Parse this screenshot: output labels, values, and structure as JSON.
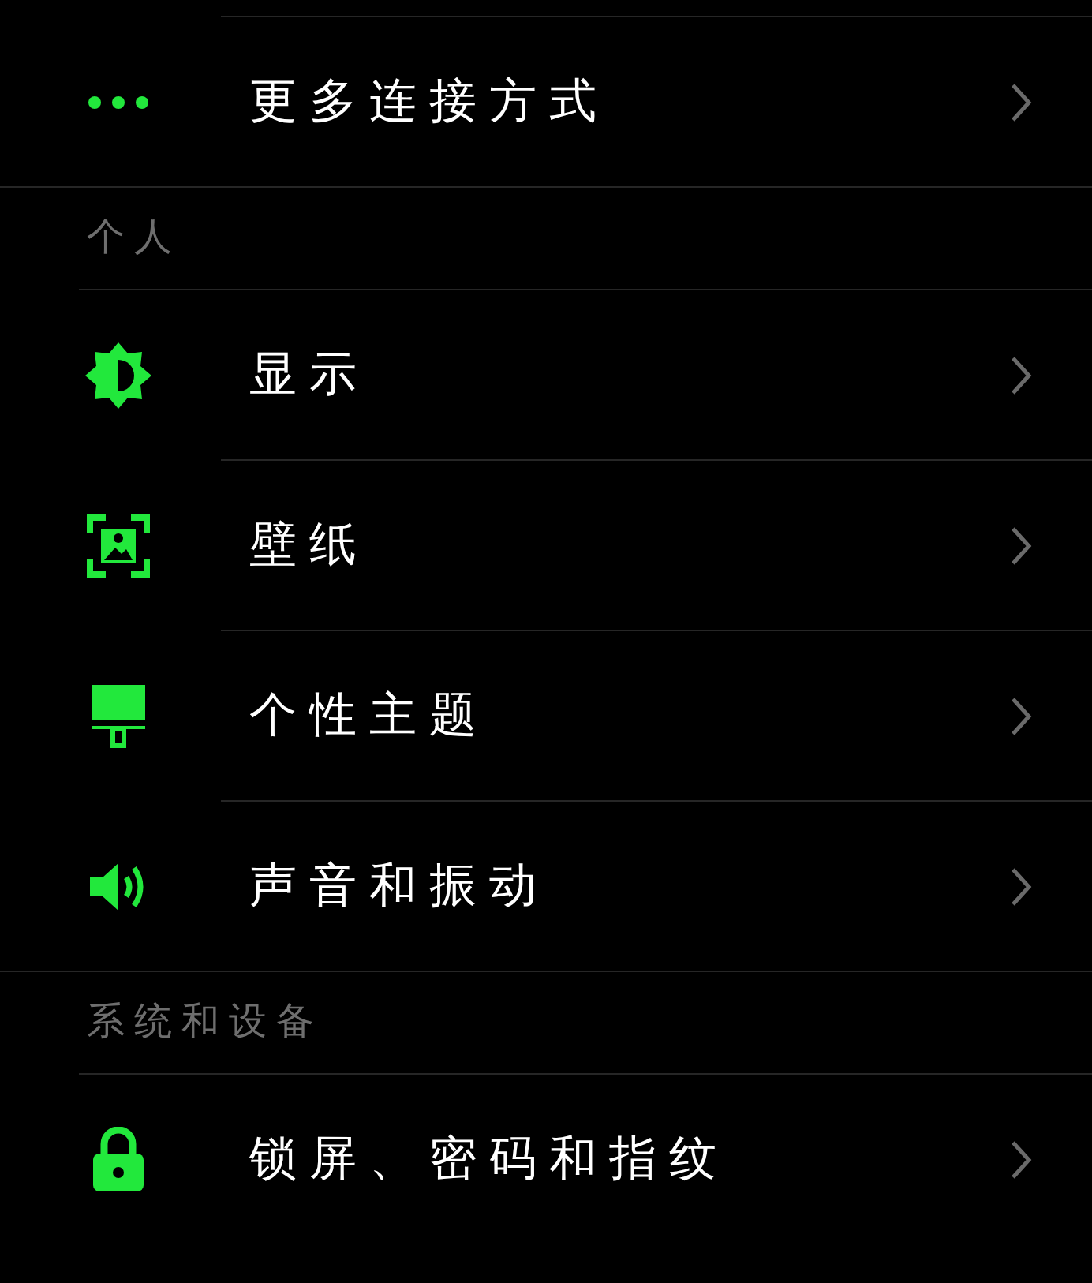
{
  "sections": [
    {
      "items": [
        {
          "kind": "more",
          "label": "更多连接方式"
        }
      ]
    },
    {
      "header": "个人",
      "items": [
        {
          "kind": "display",
          "label": "显示"
        },
        {
          "kind": "wallpaper",
          "label": "壁纸"
        },
        {
          "kind": "theme",
          "label": "个性主题"
        },
        {
          "kind": "sound",
          "label": "声音和振动"
        }
      ]
    },
    {
      "header": "系统和设备",
      "items": [
        {
          "kind": "lock",
          "label": "锁屏、密码和指纹"
        }
      ]
    }
  ]
}
